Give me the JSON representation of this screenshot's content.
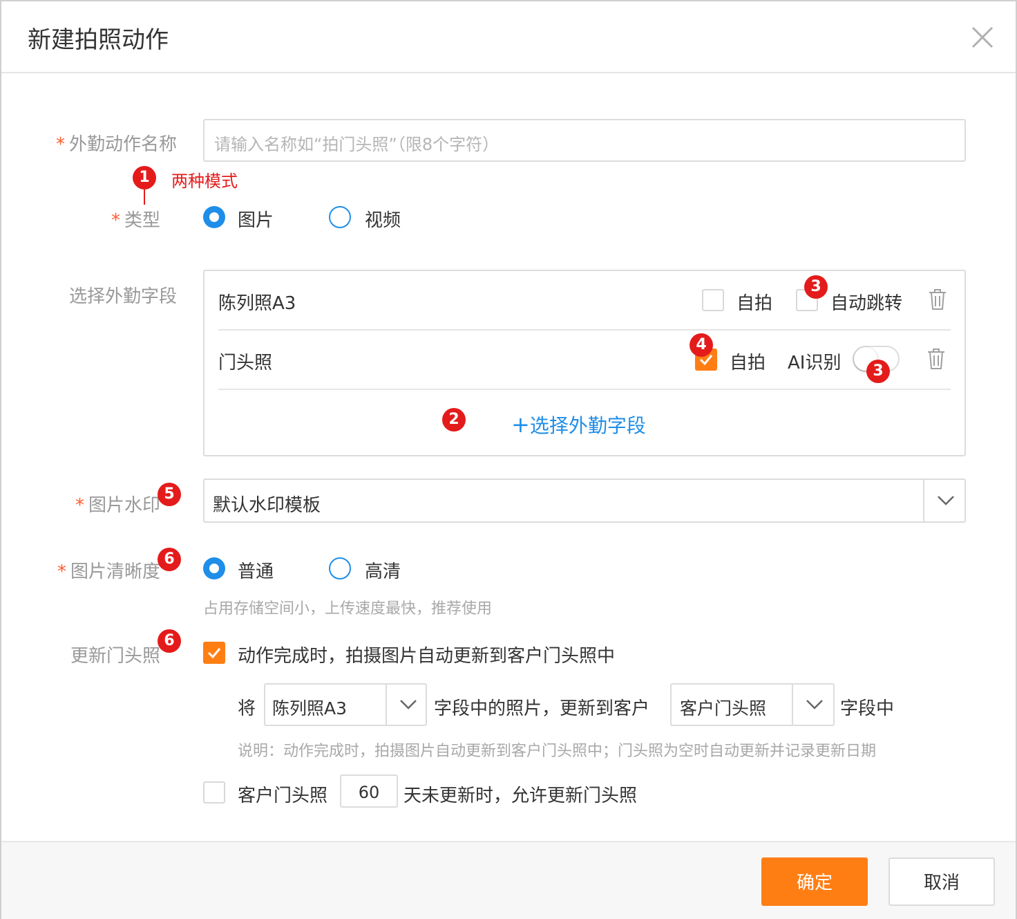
{
  "dialog": {
    "title": "新建拍照动作"
  },
  "form": {
    "action_name": {
      "label": "外勤动作名称",
      "required_mark": "*",
      "placeholder": "请输入名称如“拍门头照”（限8个字符）"
    },
    "type": {
      "label": "类型",
      "required_mark": "*",
      "options": [
        {
          "label": "图片",
          "selected": true
        },
        {
          "label": "视频",
          "selected": false
        }
      ]
    },
    "field_select": {
      "label": "选择外勤字段",
      "rows": [
        {
          "name": "陈列照A3",
          "selfie_label": "自拍",
          "selfie_checked": false,
          "auto_jump_label": "自动跳转",
          "auto_jump_checked": false
        },
        {
          "name": "门头照",
          "selfie_label": "自拍",
          "selfie_checked": true,
          "ai_label": "AI识别",
          "ai_on": false
        }
      ],
      "add_label": "选择外勤字段",
      "add_prefix": "+"
    },
    "watermark": {
      "label": "图片水印",
      "required_mark": "*",
      "value": "默认水印模板"
    },
    "clarity": {
      "label": "图片清晰度",
      "required_mark": "*",
      "options": [
        {
          "label": "普通",
          "selected": true
        },
        {
          "label": "高清",
          "selected": false
        }
      ],
      "hint": "占用存储空间小，上传速度最快，推荐使用"
    },
    "update_photo": {
      "label": "更新门头照",
      "checkbox_label": "动作完成时，拍摄图片自动更新到客户门头照中",
      "checked": true,
      "sentence": {
        "prefix": "将",
        "source_value": "陈列照A3",
        "middle": "字段中的照片，更新到客户",
        "target_value": "客户门头照",
        "suffix": "字段中"
      },
      "note": "说明：动作完成时，拍摄图片自动更新到客户门头照中；门头照为空时自动更新并记录更新日期",
      "days_rule": {
        "checked": false,
        "prefix": "客户门头照",
        "days": "60",
        "suffix": "天未更新时，允许更新门头照"
      }
    }
  },
  "annotations": {
    "badge1": "1",
    "badge1_text": "两种模式",
    "badge2": "2",
    "badge3a": "3",
    "badge3b": "3",
    "badge4": "4",
    "badge5": "5",
    "badge6a": "6",
    "badge6b": "6"
  },
  "footer": {
    "confirm_label": "确定",
    "cancel_label": "取消"
  },
  "colors": {
    "accent": "#ff7e14",
    "radio_blue": "#1f8ee8",
    "link_blue": "#1f8ee8",
    "annotation_red": "#e41b1b",
    "required_red": "#ff5a2c"
  }
}
